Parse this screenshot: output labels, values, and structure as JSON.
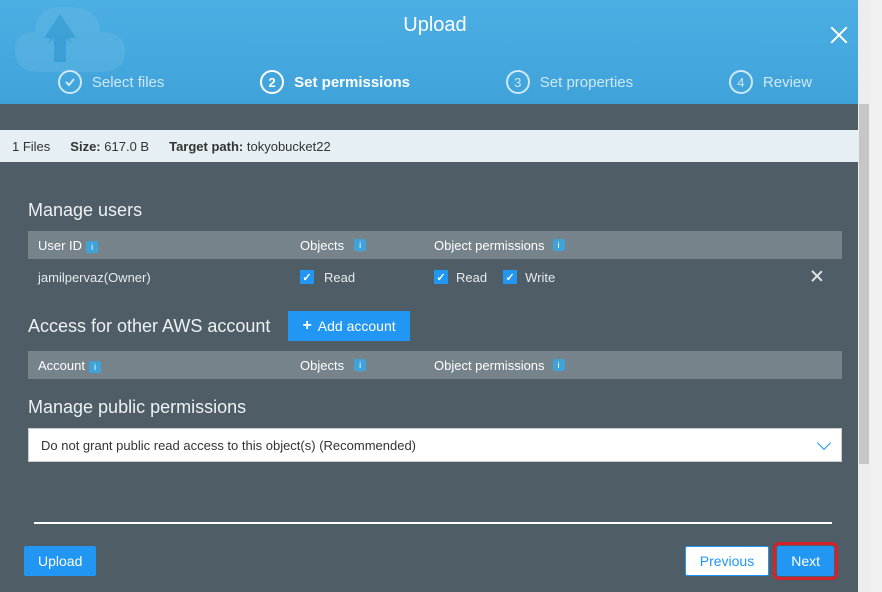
{
  "title": "Upload",
  "steps": {
    "s1": "Select files",
    "s2": "Set permissions",
    "s3": "Set properties",
    "s4": "Review",
    "n2": "2",
    "n3": "3",
    "n4": "4"
  },
  "infobar": {
    "files": "1 Files",
    "size_label": "Size:",
    "size_value": "617.0 B",
    "target_label": "Target path:",
    "target_value": "tokyobucket22"
  },
  "manage_users": {
    "title": "Manage users",
    "col_user": "User ID",
    "col_objects": "Objects",
    "col_perm": "Object permissions",
    "row": {
      "user": "jamilpervaz(Owner)",
      "obj_read": "Read",
      "perm_read": "Read",
      "perm_write": "Write"
    }
  },
  "other_account": {
    "title": "Access for other AWS account",
    "add_btn": "Add account",
    "col_account": "Account",
    "col_objects": "Objects",
    "col_perm": "Object permissions"
  },
  "public_perm": {
    "title": "Manage public permissions",
    "selected": "Do not grant public read access to this object(s) (Recommended)"
  },
  "footer": {
    "upload": "Upload",
    "prev": "Previous",
    "next": "Next"
  }
}
